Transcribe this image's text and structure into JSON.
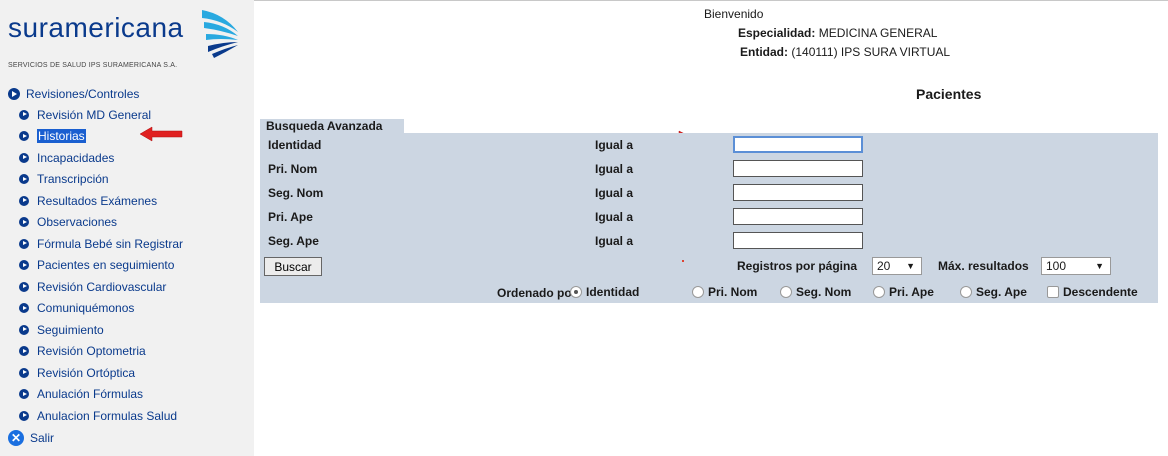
{
  "brand": {
    "name": "suramericana",
    "subtitle": "SERVICIOS DE SALUD IPS SURAMERICANA S.A."
  },
  "header": {
    "welcome": "Bienvenido",
    "specialty_label": "Especialidad:",
    "specialty_value": "MEDICINA GENERAL",
    "entity_label": "Entidad:",
    "entity_value": "(140111)  IPS SURA VIRTUAL"
  },
  "sidebar": {
    "root_label": "Revisiones/Controles",
    "items": [
      {
        "label": "Revisión MD General"
      },
      {
        "label": "Historias",
        "selected": true
      },
      {
        "label": "Incapacidades"
      },
      {
        "label": "Transcripción"
      },
      {
        "label": "Resultados Exámenes"
      },
      {
        "label": "Observaciones"
      },
      {
        "label": "Fórmula Bebé sin Registrar"
      },
      {
        "label": "Pacientes en seguimiento"
      },
      {
        "label": "Revisión Cardiovascular"
      },
      {
        "label": "Comuniquémonos"
      },
      {
        "label": "Seguimiento"
      },
      {
        "label": "Revisión Optometria"
      },
      {
        "label": "Revisión Ortóptica"
      },
      {
        "label": "Anulación Fórmulas"
      },
      {
        "label": "Anulacion Formulas Salud"
      }
    ],
    "exit_label": "Salir"
  },
  "page_title": "Pacientes",
  "search": {
    "tab_label": "Busqueda Avanzada",
    "fields": [
      {
        "label": "Identidad",
        "operator": "Igual a",
        "value": ""
      },
      {
        "label": "Pri. Nom",
        "operator": "Igual a",
        "value": ""
      },
      {
        "label": "Seg. Nom",
        "operator": "Igual a",
        "value": ""
      },
      {
        "label": "Pri. Ape",
        "operator": "Igual a",
        "value": ""
      },
      {
        "label": "Seg. Ape",
        "operator": "Igual a",
        "value": ""
      }
    ],
    "search_button": "Buscar",
    "page_size_label": "Registros por página",
    "page_size_value": "20",
    "max_results_label": "Máx. resultados",
    "max_results_value": "100",
    "order_label": "Ordenado por:",
    "order_options": [
      {
        "label": "Identidad",
        "selected": true
      },
      {
        "label": "Pri. Nom",
        "selected": false
      },
      {
        "label": "Seg. Nom",
        "selected": false
      },
      {
        "label": "Pri. Ape",
        "selected": false
      },
      {
        "label": "Seg. Ape",
        "selected": false
      }
    ],
    "descending_label": "Descendente",
    "descending_checked": false
  },
  "colors": {
    "brand_blue": "#0a3a8c",
    "panel_bg": "#ccd6e2",
    "sidebar_bg": "#f1f1f1",
    "annotation_red": "#e02020",
    "selection_blue": "#1a5fd0"
  }
}
